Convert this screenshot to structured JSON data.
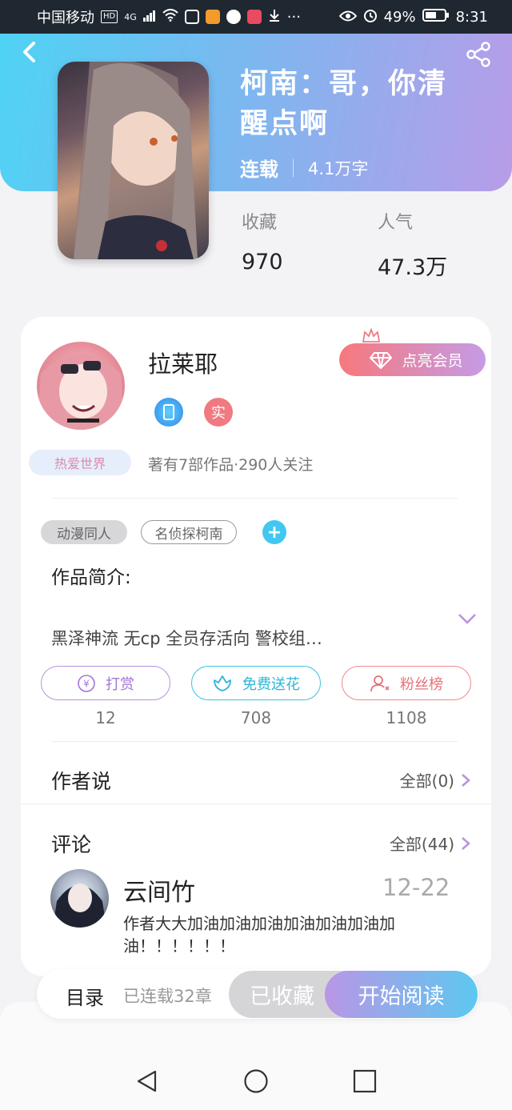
{
  "status_bar": {
    "carrier": "中国移动",
    "hd": "HD",
    "network": "4G",
    "battery": "49%",
    "time": "8:31"
  },
  "book": {
    "title": "柯南：哥，你清醒点啊",
    "status": "连载",
    "words": "4.1万字",
    "stats": {
      "favorites_label": "收藏",
      "favorites_value": "970",
      "popularity_label": "人气",
      "popularity_value": "47.3万"
    }
  },
  "author": {
    "name": "拉莱耶",
    "badge": "热爱世界",
    "real_label": "实",
    "vip_button": "点亮会员",
    "stats": "著有7部作品·290人关注"
  },
  "tags": [
    "动漫同人",
    "名侦探柯南"
  ],
  "intro": {
    "label": "作品简介:",
    "text": "黑泽神流 无cp 全员存活向 警校组…"
  },
  "actions": [
    {
      "label": "打赏",
      "count": "12",
      "icon": "yuan-icon",
      "color": "#a076d6"
    },
    {
      "label": "免费送花",
      "count": "708",
      "icon": "flower-icon",
      "color": "#2eb5d8"
    },
    {
      "label": "粉丝榜",
      "count": "1108",
      "icon": "fans-icon",
      "color": "#e67278"
    }
  ],
  "author_says": {
    "title": "作者说",
    "link": "全部(0)"
  },
  "comments": {
    "title": "评论",
    "link": "全部(44)",
    "items": [
      {
        "user": "云间竹",
        "date": "12-22",
        "text": "作者大大加油加油加油加油加油加油加油！！！！！！"
      }
    ]
  },
  "bottom_bar": {
    "toc": "目录",
    "chapters": "已连载32章",
    "collected": "已收藏",
    "read": "开始阅读"
  },
  "colors": {
    "accent_blue": "#4fd3f5",
    "accent_purple": "#b89ce8",
    "vip_pink": "#f7787c"
  }
}
